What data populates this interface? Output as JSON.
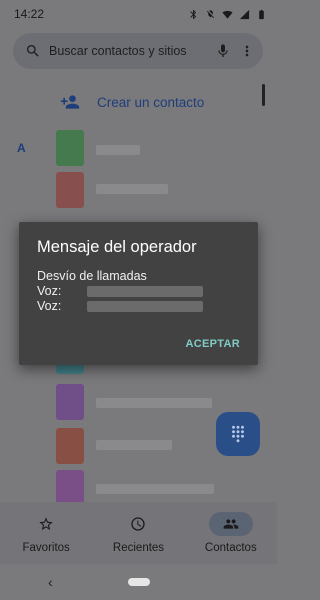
{
  "status_bar": {
    "time": "14:22"
  },
  "search": {
    "placeholder": "Buscar contactos y sitios"
  },
  "create_contact": {
    "label": "Crear un contacto"
  },
  "section_letter": "A",
  "dialog": {
    "title": "Mensaje del operador",
    "lines": [
      "Desvío de llamadas",
      "Voz:",
      "Voz:"
    ],
    "button": "ACEPTAR"
  },
  "bottom_nav": {
    "items": [
      {
        "label": "Favoritos",
        "icon": "star-icon"
      },
      {
        "label": "Recientes",
        "icon": "clock-icon"
      },
      {
        "label": "Contactos",
        "icon": "people-icon"
      }
    ],
    "active": "Contactos"
  },
  "colors": {
    "accent": "#1f3d7a",
    "dialog_bg": "#424242",
    "dialog_button": "#80cbc4",
    "fab": "#2a4f88"
  }
}
